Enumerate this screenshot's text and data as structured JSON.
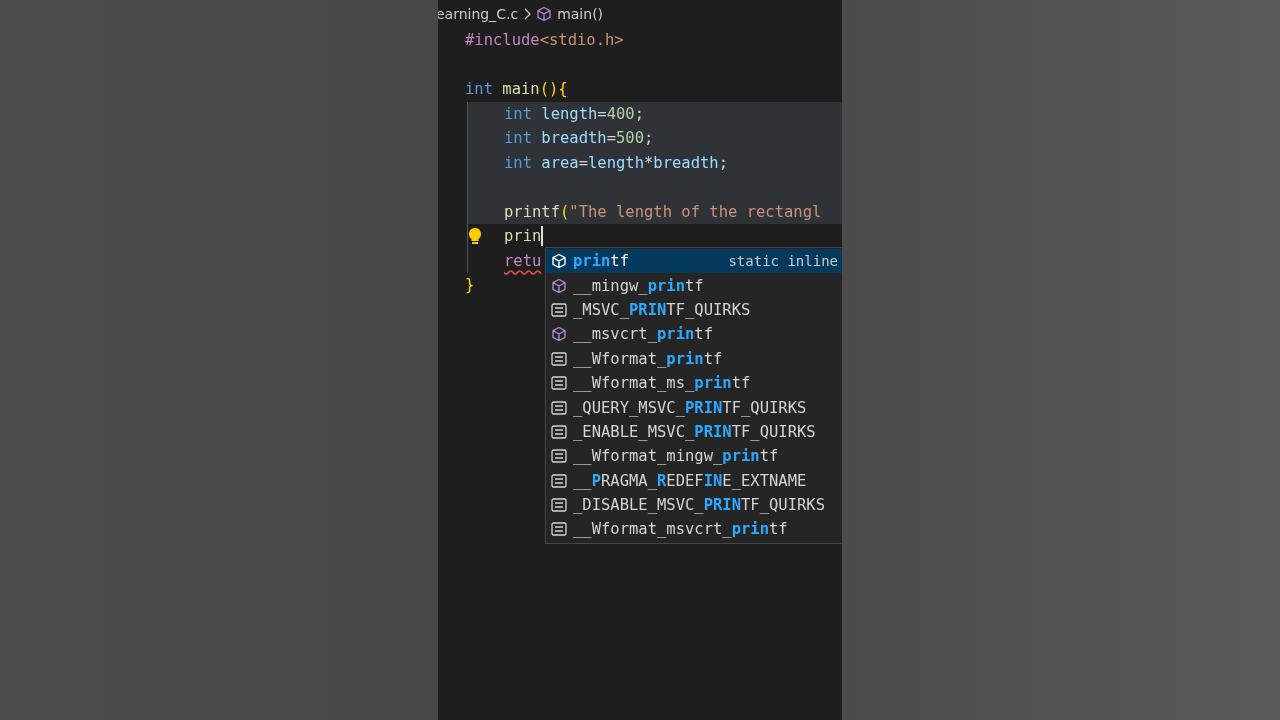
{
  "breadcrumb": {
    "file": "earning_C.c",
    "symbol": "main()"
  },
  "code": [
    {
      "tokens": [
        {
          "kind": "directive",
          "text": "#include"
        },
        {
          "kind": "header",
          "text": "<stdio.h>"
        }
      ]
    },
    {
      "highlighted": false
    },
    {
      "tokens": [
        {
          "kind": "keyword",
          "text": "int"
        },
        {
          "kind": "function",
          "text": "main"
        },
        {
          "kind": "bracket",
          "text": "(){"
        }
      ],
      "children": [
        {
          "highlighted": true,
          "tokens": [
            {
              "kind": "keyword",
              "text": "int"
            },
            {
              "kind": "variable",
              "text": "length"
            },
            {
              "kind": "plain",
              "text": "="
            },
            {
              "kind": "number",
              "text": "400"
            },
            {
              "kind": "plain",
              "text": ";"
            }
          ]
        },
        {
          "highlighted": true,
          "tokens": [
            {
              "kind": "keyword",
              "text": "int"
            },
            {
              "kind": "variable",
              "text": "breadth"
            },
            {
              "kind": "plain",
              "text": "="
            },
            {
              "kind": "number",
              "text": "500"
            },
            {
              "kind": "plain",
              "text": ";"
            }
          ]
        },
        {
          "highlighted": true,
          "tokens": [
            {
              "kind": "keyword",
              "text": "int"
            },
            {
              "kind": "variable",
              "text": "area"
            },
            {
              "kind": "plain",
              "text": "="
            },
            {
              "kind": "variable",
              "text": "length"
            },
            {
              "kind": "plain",
              "text": "*"
            },
            {
              "kind": "variable",
              "text": "breadth"
            },
            {
              "kind": "plain",
              "text": ";"
            }
          ]
        },
        {
          "highlighted": true
        },
        {
          "highlighted": true,
          "tokens": [
            {
              "kind": "function",
              "text": "printf"
            },
            {
              "kind": "bracket",
              "text": "("
            },
            {
              "kind": "string",
              "text": "\"The length of the rectangl"
            }
          ]
        },
        {
          "highlighted": false,
          "lightbulb": true,
          "cursor": true,
          "tokens": [
            {
              "kind": "function",
              "text": "prin"
            }
          ]
        },
        {
          "highlighted": false,
          "error": true,
          "tokens": [
            {
              "kind": "directive",
              "text": "retu"
            }
          ]
        }
      ]
    },
    {
      "tokens": [
        {
          "kind": "bracket",
          "text": "}"
        }
      ]
    }
  ],
  "suggestions": [
    {
      "kind": "function",
      "label": "**prin**tf",
      "detail": "static inline",
      "selected": true
    },
    {
      "kind": "function",
      "label": "__mingw_**prin**tf",
      "selected": false
    },
    {
      "kind": "macro",
      "label": "_MSVC_**PRIN**TF_QUIRKS",
      "selected": false
    },
    {
      "kind": "function",
      "label": "__msvcrt_**prin**tf",
      "selected": false
    },
    {
      "kind": "macro",
      "label": "__Wformat_**prin**tf",
      "selected": false
    },
    {
      "kind": "macro",
      "label": "__Wformat_ms_**prin**tf",
      "selected": false
    },
    {
      "kind": "macro",
      "label": "_QUERY_MSVC_**PRIN**TF_QUIRKS",
      "selected": false
    },
    {
      "kind": "macro",
      "label": "_ENABLE_MSVC_**PRIN**TF_QUIRKS",
      "selected": false
    },
    {
      "kind": "macro",
      "label": "__Wformat_mingw_**prin**tf",
      "selected": false
    },
    {
      "kind": "macro",
      "label": "__**P**RAGMA_**R**EDEF**IN**E_EXTNAME",
      "selected": false
    },
    {
      "kind": "macro",
      "label": "_DISABLE_MSVC_**PRIN**TF_QUIRKS",
      "selected": false
    },
    {
      "kind": "macro",
      "label": "__Wformat_msvcrt_**prin**tf",
      "selected": false
    }
  ]
}
